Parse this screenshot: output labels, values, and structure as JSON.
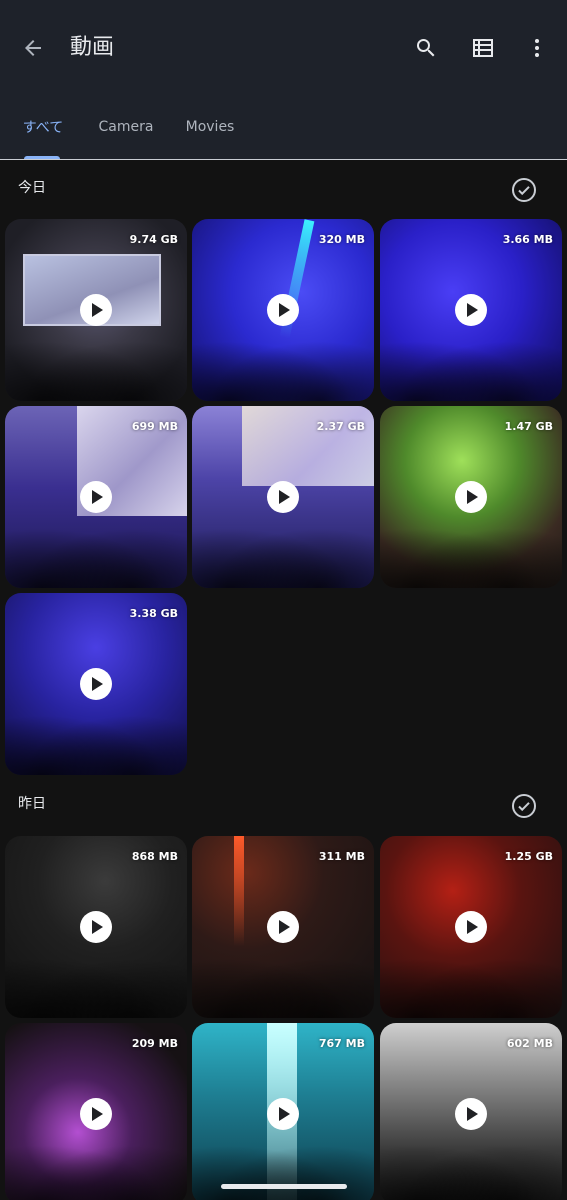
{
  "app": {
    "title": "動画"
  },
  "tabs": [
    {
      "label": "すべて",
      "active": true
    },
    {
      "label": "Camera",
      "active": false
    },
    {
      "label": "Movies",
      "active": false
    }
  ],
  "icons": {
    "back": "arrow-back-icon",
    "search": "search-icon",
    "list_view": "list-view-icon",
    "more": "more-vert-icon",
    "select_all": "check-circle-icon",
    "play": "play-icon"
  },
  "colors": {
    "accent": "#8ab4f8",
    "topbar": "#1e222a",
    "background": "#121212"
  },
  "sections": [
    {
      "title": "今日",
      "videos": [
        {
          "size": "9.74 GB"
        },
        {
          "size": "320 MB"
        },
        {
          "size": "3.66 MB"
        },
        {
          "size": "699 MB"
        },
        {
          "size": "2.37 GB"
        },
        {
          "size": "1.47 GB"
        },
        {
          "size": "3.38 GB"
        }
      ]
    },
    {
      "title": "昨日",
      "videos": [
        {
          "size": "868 MB"
        },
        {
          "size": "311 MB"
        },
        {
          "size": "1.25 GB"
        },
        {
          "size": "209 MB"
        },
        {
          "size": "767 MB"
        },
        {
          "size": "602 MB"
        }
      ]
    }
  ]
}
